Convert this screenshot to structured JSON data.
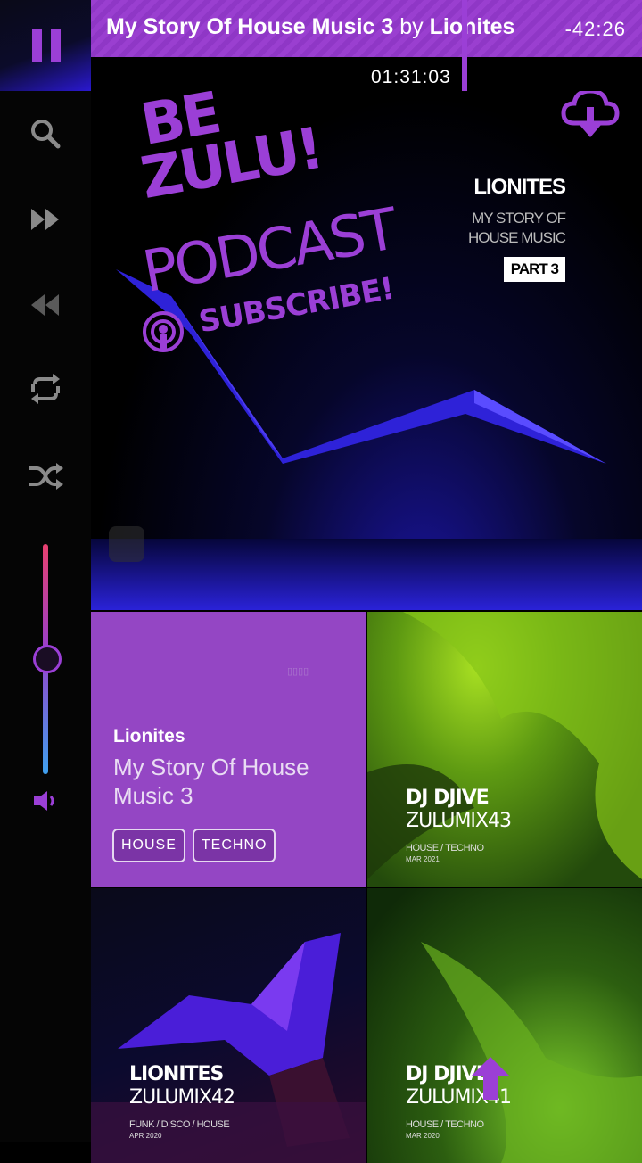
{
  "now_playing": {
    "title": "My Story Of House Music 3",
    "by": "by",
    "artist": "Lionites",
    "remaining": "-42:26",
    "elapsed": "01:31:03"
  },
  "sidebar": {
    "icons": [
      "pause-icon",
      "search-icon",
      "fast-forward-icon",
      "rewind-icon",
      "repeat-icon",
      "shuffle-icon",
      "volume-icon"
    ],
    "volume_level": 0.5
  },
  "hero": {
    "brand_line1": "BE",
    "brand_line2": "ZULU!",
    "brand_line3": "PODCAST",
    "cta": "SUBSCRIBE!",
    "artist": "LIONITES",
    "subtitle_line1": "MY STORY OF",
    "subtitle_line2": "HOUSE MUSIC",
    "part": "PART 3"
  },
  "featured": {
    "artist": "Lionites",
    "title": "My Story Of House Music 3",
    "genres": [
      "HOUSE",
      "TECHNO"
    ]
  },
  "tiles": [
    {
      "artist": "DJ DJIVE",
      "title": "ZULUMIX43",
      "genre": "HOUSE / TECHNO",
      "date": "MAR 2021"
    },
    {
      "artist": "LIONITES",
      "title": "ZULUMIX42",
      "genre": "FUNK / DISCO / HOUSE",
      "date": "APR 2020"
    },
    {
      "artist": "DJ DJIVE",
      "title": "ZULUMIX41",
      "genre": "HOUSE / TECHNO",
      "date": "MAR 2020"
    }
  ],
  "colors": {
    "accent": "#9b3fd6",
    "background": "#000000"
  }
}
